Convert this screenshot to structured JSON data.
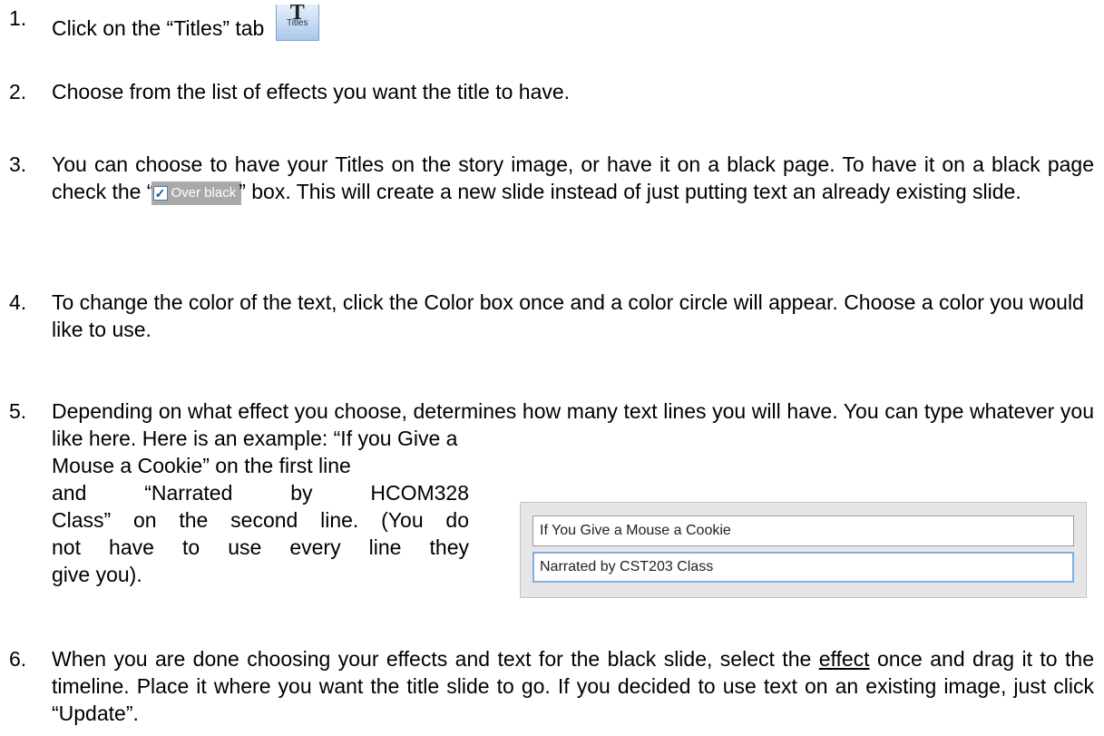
{
  "steps": [
    {
      "num": "1.",
      "text": "Click on the “Titles” tab",
      "icon_label": "Titles",
      "icon_glyph": "T"
    },
    {
      "num": "2.",
      "text": "Choose from the list of effects you want the title to have."
    },
    {
      "num": "3.",
      "text_a": "You can choose to have your Titles on the story image, or have it on a black page. To have it on a black page check the “",
      "checkbox_label": "Over black",
      "text_b": "” box. This will create a  new slide instead of just putting text an already existing slide."
    },
    {
      "num": "4.",
      "text": "To change the color of the text, click the Color box once and a color circle will appear. Choose a color you would like to use."
    },
    {
      "num": "5.",
      "text_a": "Depending on what effect you choose, determines how many text lines you will have. You can type whatever you like here. Here is an example: “If you Give a",
      "text_b": "Mouse a Cookie” on the first line",
      "text_c": "and “Narrated by HCOM328",
      "text_d": "Class” on the second line. (You do",
      "text_e": "not have to use every line they",
      "text_f": "give you).",
      "line1_value": "If You Give a Mouse a Cookie",
      "line2_value": "Narrated by CST203 Class"
    },
    {
      "num": "6.",
      "text_a": "When you are done choosing your effects and text for the black slide, select the ",
      "text_u": "effect",
      "text_b": " once and drag it to the timeline. Place it where you want the title slide to go. If you decided to use text on an existing image, just click “Update”."
    }
  ]
}
